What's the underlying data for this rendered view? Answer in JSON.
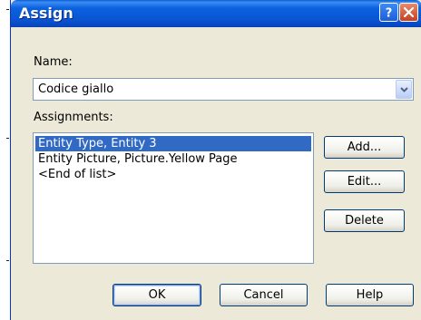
{
  "window": {
    "title": "Assign"
  },
  "form": {
    "name_label": "Name:",
    "name_value": "Codice giallo",
    "assignments_label": "Assignments:"
  },
  "assignments": {
    "items": [
      {
        "label": "Entity Type, Entity 3",
        "selected": true
      },
      {
        "label": "Entity Picture, Picture.Yellow Page",
        "selected": false
      },
      {
        "label": "<End of list>",
        "selected": false
      }
    ]
  },
  "buttons": {
    "add": "Add...",
    "edit": "Edit...",
    "delete": "Delete",
    "ok": "OK",
    "cancel": "Cancel",
    "help": "Help"
  },
  "icons": {
    "help": "help-icon",
    "close": "close-icon",
    "dropdown": "chevron-down-icon"
  },
  "colors": {
    "titlebar": "#0a56d4",
    "dialog_bg": "#ece9d8",
    "selection": "#316ac5",
    "close_button": "#c4401f"
  }
}
